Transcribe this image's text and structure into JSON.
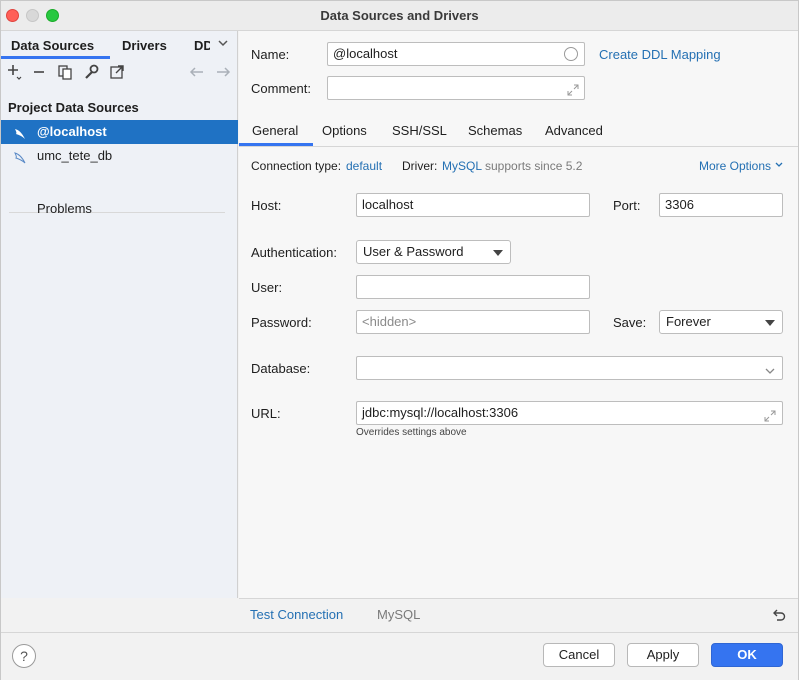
{
  "window": {
    "title": "Data Sources and Drivers"
  },
  "left": {
    "tabs": [
      "Data Sources",
      "Drivers",
      "DD"
    ],
    "section_title": "Project Data Sources",
    "data_sources": [
      {
        "label": "@localhost",
        "selected": true
      },
      {
        "label": "umc_tete_db",
        "selected": false
      }
    ],
    "problems_label": "Problems",
    "toolbar_icons": [
      "add-icon",
      "remove-icon",
      "duplicate-icon",
      "wrench-icon",
      "export-icon",
      "back-arrow-icon",
      "forward-arrow-icon"
    ]
  },
  "form": {
    "name_label": "Name:",
    "name_value": "@localhost",
    "ddl_link": "Create DDL Mapping",
    "comment_label": "Comment:",
    "comment_value": ""
  },
  "tabs": [
    "General",
    "Options",
    "SSH/SSL",
    "Schemas",
    "Advanced"
  ],
  "general": {
    "conn_type_label": "Connection type:",
    "conn_type_value": "default",
    "driver_label": "Driver:",
    "driver_value": "MySQL",
    "driver_note": "supports since 5.2",
    "more_options": "More Options",
    "host_label": "Host:",
    "host_value": "localhost",
    "port_label": "Port:",
    "port_value": "3306",
    "auth_label": "Authentication:",
    "auth_value": "User & Password",
    "user_label": "User:",
    "user_value": "",
    "password_label": "Password:",
    "password_placeholder": "<hidden>",
    "save_label": "Save:",
    "save_value": "Forever",
    "database_label": "Database:",
    "database_value": "",
    "url_label": "URL:",
    "url_value": "jdbc:mysql://localhost:3306",
    "url_note": "Overrides settings above"
  },
  "bottom": {
    "test_connection": "Test Connection",
    "driver_name": "MySQL"
  },
  "footer": {
    "help": "?",
    "cancel": "Cancel",
    "apply": "Apply",
    "ok": "OK"
  },
  "colors": {
    "accent": "#3574f0",
    "selection": "#1f72c4",
    "link": "#2470b3"
  }
}
